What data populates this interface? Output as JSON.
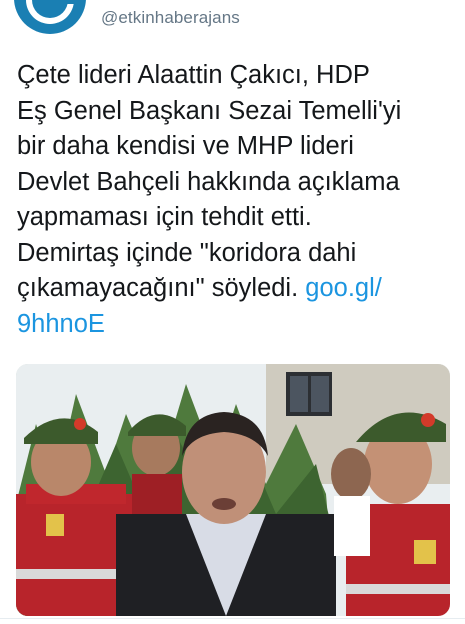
{
  "account": {
    "handle": "@etkinhaberajans",
    "avatar_icon": "news-agency-logo-icon"
  },
  "tweet": {
    "text": "Çete lideri Alaattin Çakıcı, HDP\nEş Genel Başkanı Sezai Temelli'yi\nbir daha kendisi ve MHP lideri\nDevlet Bahçeli hakkında açıklama\nyapmaması için tehdit etti.\nDemirtaş içinde \"koridora dahi\nçıkamayacağını\" söyledi. ",
    "link_line1": "goo.gl/",
    "link_line2": "9hhnoE"
  },
  "media": {
    "description_icon": "news-photo",
    "colors": {
      "sky": "#e9eef0",
      "trees": "#4f7a3d",
      "uniform_red": "#c0272d",
      "beret_green": "#3c5a2c",
      "suit": "#1f2024"
    }
  },
  "colors": {
    "link": "#1b95e0",
    "text": "#14171a",
    "handle": "#657786"
  }
}
